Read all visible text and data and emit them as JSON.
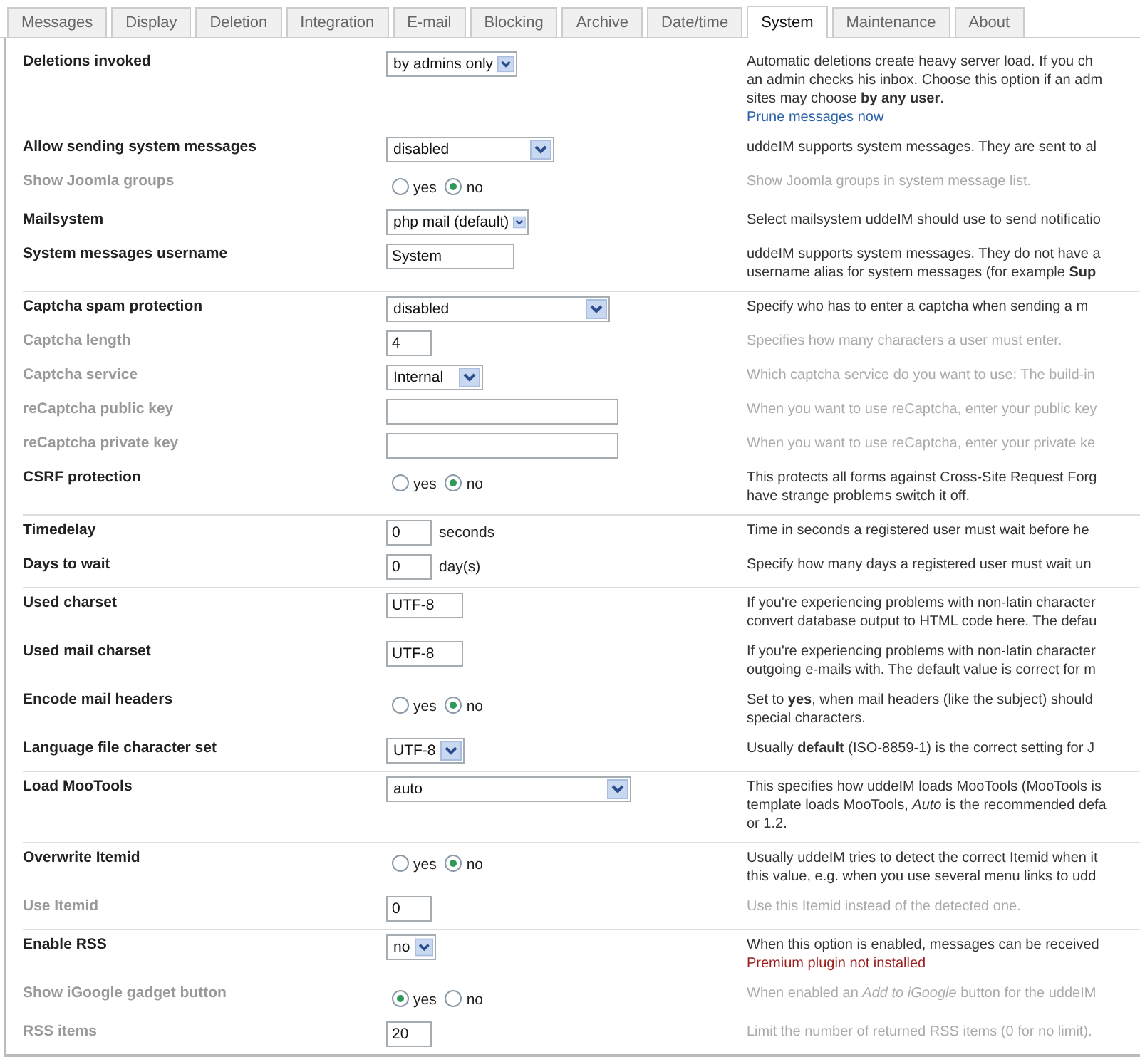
{
  "tabs": [
    {
      "label": "Messages",
      "selected": false
    },
    {
      "label": "Display",
      "selected": false
    },
    {
      "label": "Deletion",
      "selected": false
    },
    {
      "label": "Integration",
      "selected": false
    },
    {
      "label": "E-mail",
      "selected": false
    },
    {
      "label": "Blocking",
      "selected": false
    },
    {
      "label": "Archive",
      "selected": false
    },
    {
      "label": "Date/time",
      "selected": false
    },
    {
      "label": "System",
      "selected": true
    },
    {
      "label": "Maintenance",
      "selected": false
    },
    {
      "label": "About",
      "selected": false
    }
  ],
  "groups": [
    {
      "rows": [
        {
          "label": "Deletions invoked",
          "disabled": false,
          "control": {
            "kind": "select",
            "value": "by admins only"
          },
          "description": [
            "Automatic deletions create heavy server load. If you ch",
            "an admin checks his inbox. Choose this option if an adm",
            "sites may choose **by any user**."
          ],
          "link": "Prune messages now"
        },
        {
          "label": "Allow sending system messages",
          "disabled": false,
          "control": {
            "kind": "select",
            "value": "disabled"
          },
          "description": [
            "uddeIM supports system messages. They are sent to al"
          ]
        },
        {
          "label": "Show Joomla groups",
          "disabled": true,
          "control": {
            "kind": "radio",
            "options": [
              {
                "label": "yes",
                "selected": false
              },
              {
                "label": "no",
                "selected": true
              }
            ]
          },
          "description": [
            "Show Joomla groups in system message list."
          ]
        },
        {
          "label": "Mailsystem",
          "disabled": false,
          "control": {
            "kind": "select",
            "value": "php mail (default)"
          },
          "description": [
            "Select mailsystem uddeIM should use to send notificatio"
          ]
        },
        {
          "label": "System messages username",
          "disabled": false,
          "control": {
            "kind": "text",
            "value": "System"
          },
          "description": [
            "uddeIM supports system messages. They do not have a",
            "username alias for system messages (for example **Sup**"
          ]
        }
      ]
    },
    {
      "rows": [
        {
          "label": "Captcha spam protection",
          "disabled": false,
          "control": {
            "kind": "select",
            "value": "disabled"
          },
          "description": [
            "Specify who has to enter a captcha when sending a m"
          ]
        },
        {
          "label": "Captcha length",
          "disabled": true,
          "control": {
            "kind": "text",
            "value": "4"
          },
          "description": [
            "Specifies how many characters a user must enter."
          ]
        },
        {
          "label": "Captcha service",
          "disabled": true,
          "control": {
            "kind": "select",
            "value": "Internal"
          },
          "description": [
            "Which captcha service do you want to use: The build-in"
          ]
        },
        {
          "label": "reCaptcha public key",
          "disabled": true,
          "control": {
            "kind": "text"
          },
          "description": [
            "When you want to use reCaptcha, enter your public key"
          ]
        },
        {
          "label": "reCaptcha private key",
          "disabled": true,
          "control": {
            "kind": "text"
          },
          "description": [
            "When you want to use reCaptcha, enter your private ke"
          ]
        },
        {
          "label": "CSRF protection",
          "disabled": false,
          "control": {
            "kind": "radio",
            "options": [
              {
                "label": "yes",
                "selected": false
              },
              {
                "label": "no",
                "selected": true
              }
            ]
          },
          "description": [
            "This protects all forms against Cross-Site Request Forg",
            "have strange problems switch it off."
          ]
        }
      ]
    },
    {
      "rows": [
        {
          "label": "Timedelay",
          "disabled": false,
          "control": {
            "kind": "text",
            "value": "0",
            "suffix": "seconds"
          },
          "description": [
            "Time in seconds a registered user must wait before he"
          ]
        },
        {
          "label": "Days to wait",
          "disabled": false,
          "control": {
            "kind": "text",
            "value": "0",
            "suffix": "day(s)"
          },
          "description": [
            "Specify how many days a registered user must wait un"
          ]
        }
      ]
    },
    {
      "rows": [
        {
          "label": "Used charset",
          "disabled": false,
          "control": {
            "kind": "text",
            "value": "UTF-8"
          },
          "description": [
            "If you're experiencing problems with non-latin character",
            "convert database output to HTML code here. The defau"
          ]
        },
        {
          "label": "Used mail charset",
          "disabled": false,
          "control": {
            "kind": "text",
            "value": "UTF-8"
          },
          "description": [
            "If you're experiencing problems with non-latin character",
            "outgoing e-mails with. The default value is correct for m"
          ]
        },
        {
          "label": "Encode mail headers",
          "disabled": false,
          "control": {
            "kind": "radio",
            "options": [
              {
                "label": "yes",
                "selected": false
              },
              {
                "label": "no",
                "selected": true
              }
            ]
          },
          "description": [
            "Set to **yes**, when mail headers (like the subject) should",
            "special characters."
          ]
        },
        {
          "label": "Language file character set",
          "disabled": false,
          "control": {
            "kind": "select",
            "value": "UTF-8"
          },
          "description": [
            "Usually **default** (ISO-8859-1) is the correct setting for J"
          ]
        }
      ]
    },
    {
      "rows": [
        {
          "label": "Load MooTools",
          "disabled": false,
          "control": {
            "kind": "select",
            "value": "auto"
          },
          "description": [
            "This specifies how uddeIM loads MooTools (MooTools is",
            "template loads MooTools, *Auto* is the recommended defa",
            "or 1.2."
          ]
        }
      ]
    },
    {
      "rows": [
        {
          "label": "Overwrite Itemid",
          "disabled": false,
          "control": {
            "kind": "radio",
            "options": [
              {
                "label": "yes",
                "selected": false
              },
              {
                "label": "no",
                "selected": true
              }
            ]
          },
          "description": [
            "Usually uddeIM tries to detect the correct Itemid when it",
            "this value, e.g. when you use several menu links to udd"
          ]
        },
        {
          "label": "Use Itemid",
          "disabled": true,
          "control": {
            "kind": "text",
            "value": "0"
          },
          "description": [
            "Use this Itemid instead of the detected one."
          ]
        }
      ]
    },
    {
      "rows": [
        {
          "label": "Enable RSS",
          "disabled": false,
          "control": {
            "kind": "select",
            "value": "no"
          },
          "description": [
            "When this option is enabled, messages can be received"
          ],
          "note": "Premium plugin not installed"
        },
        {
          "label": "Show iGoogle gadget button",
          "disabled": true,
          "control": {
            "kind": "radio",
            "options": [
              {
                "label": "yes",
                "selected": true
              },
              {
                "label": "no",
                "selected": false
              }
            ]
          },
          "description": [
            "When enabled an *Add to iGoogle* button for the uddeIM"
          ]
        },
        {
          "label": "RSS items",
          "disabled": true,
          "control": {
            "kind": "text",
            "value": "20"
          },
          "description": [
            "Limit the number of returned RSS items (0 for no limit)."
          ]
        }
      ]
    }
  ]
}
